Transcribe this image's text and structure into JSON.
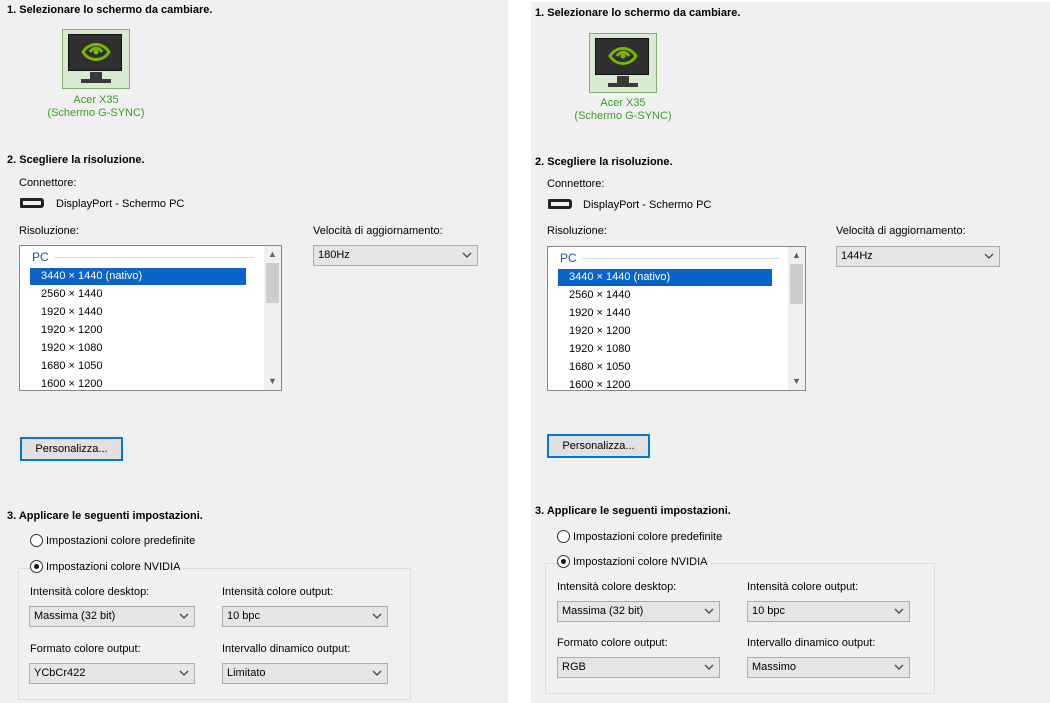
{
  "panels": [
    {
      "step1": {
        "heading": "1. Selezionare lo schermo da cambiare."
      },
      "monitor": {
        "icon": "nvidia-monitor-icon",
        "name_line1": "Acer X35",
        "name_line2": "(Schermo G-SYNC)"
      },
      "step2": {
        "heading": "2. Scegliere la risoluzione."
      },
      "connector": {
        "label": "Connettore:",
        "icon": "displayport-icon",
        "value": "DisplayPort - Schermo PC"
      },
      "resolution": {
        "label": "Risoluzione:",
        "group": "PC",
        "items": [
          "3440 × 1440 (nativo)",
          "2560 × 1440",
          "1920 × 1440",
          "1920 × 1200",
          "1920 × 1080",
          "1680 × 1050",
          "1600 × 1200"
        ],
        "selected_index": 0
      },
      "refresh": {
        "label": "Velocità di aggiornamento:",
        "value": "180Hz"
      },
      "customize_button": "Personalizza...",
      "step3": {
        "heading": "3. Applicare le seguenti impostazioni."
      },
      "radio_default": {
        "label": "Impostazioni colore predefinite",
        "checked": false
      },
      "radio_nvidia": {
        "label": "Impostazioni colore NVIDIA",
        "checked": true
      },
      "desktop_depth": {
        "label": "Intensità colore desktop:",
        "value": "Massima (32 bit)"
      },
      "output_depth": {
        "label": "Intensità colore output:",
        "value": "10 bpc"
      },
      "output_format": {
        "label": "Formato colore output:",
        "value": "YCbCr422"
      },
      "dynamic_range": {
        "label": "Intervallo dinamico output:",
        "value": "Limitato"
      }
    },
    {
      "step1": {
        "heading": "1. Selezionare lo schermo da cambiare."
      },
      "monitor": {
        "icon": "nvidia-monitor-icon",
        "name_line1": "Acer X35",
        "name_line2": "(Schermo G-SYNC)"
      },
      "step2": {
        "heading": "2. Scegliere la risoluzione."
      },
      "connector": {
        "label": "Connettore:",
        "icon": "displayport-icon",
        "value": "DisplayPort - Schermo PC"
      },
      "resolution": {
        "label": "Risoluzione:",
        "group": "PC",
        "items": [
          "3440 × 1440 (nativo)",
          "2560 × 1440",
          "1920 × 1440",
          "1920 × 1200",
          "1920 × 1080",
          "1680 × 1050",
          "1600 × 1200"
        ],
        "selected_index": 0
      },
      "refresh": {
        "label": "Velocità di aggiornamento:",
        "value": "144Hz"
      },
      "customize_button": "Personalizza...",
      "step3": {
        "heading": "3. Applicare le seguenti impostazioni."
      },
      "radio_default": {
        "label": "Impostazioni colore predefinite",
        "checked": false
      },
      "radio_nvidia": {
        "label": "Impostazioni colore NVIDIA",
        "checked": true
      },
      "desktop_depth": {
        "label": "Intensità colore desktop:",
        "value": "Massima (32 bit)"
      },
      "output_depth": {
        "label": "Intensità colore output:",
        "value": "10 bpc"
      },
      "output_format": {
        "label": "Formato colore output:",
        "value": "RGB"
      },
      "dynamic_range": {
        "label": "Intervallo dinamico output:",
        "value": "Massimo"
      }
    }
  ],
  "colors": {
    "accent": "#0078d7",
    "selection": "#0a64c8",
    "monitor_name": "#3a9d23",
    "group_header": "#1f4fa8",
    "background": "#f0f0f0"
  }
}
